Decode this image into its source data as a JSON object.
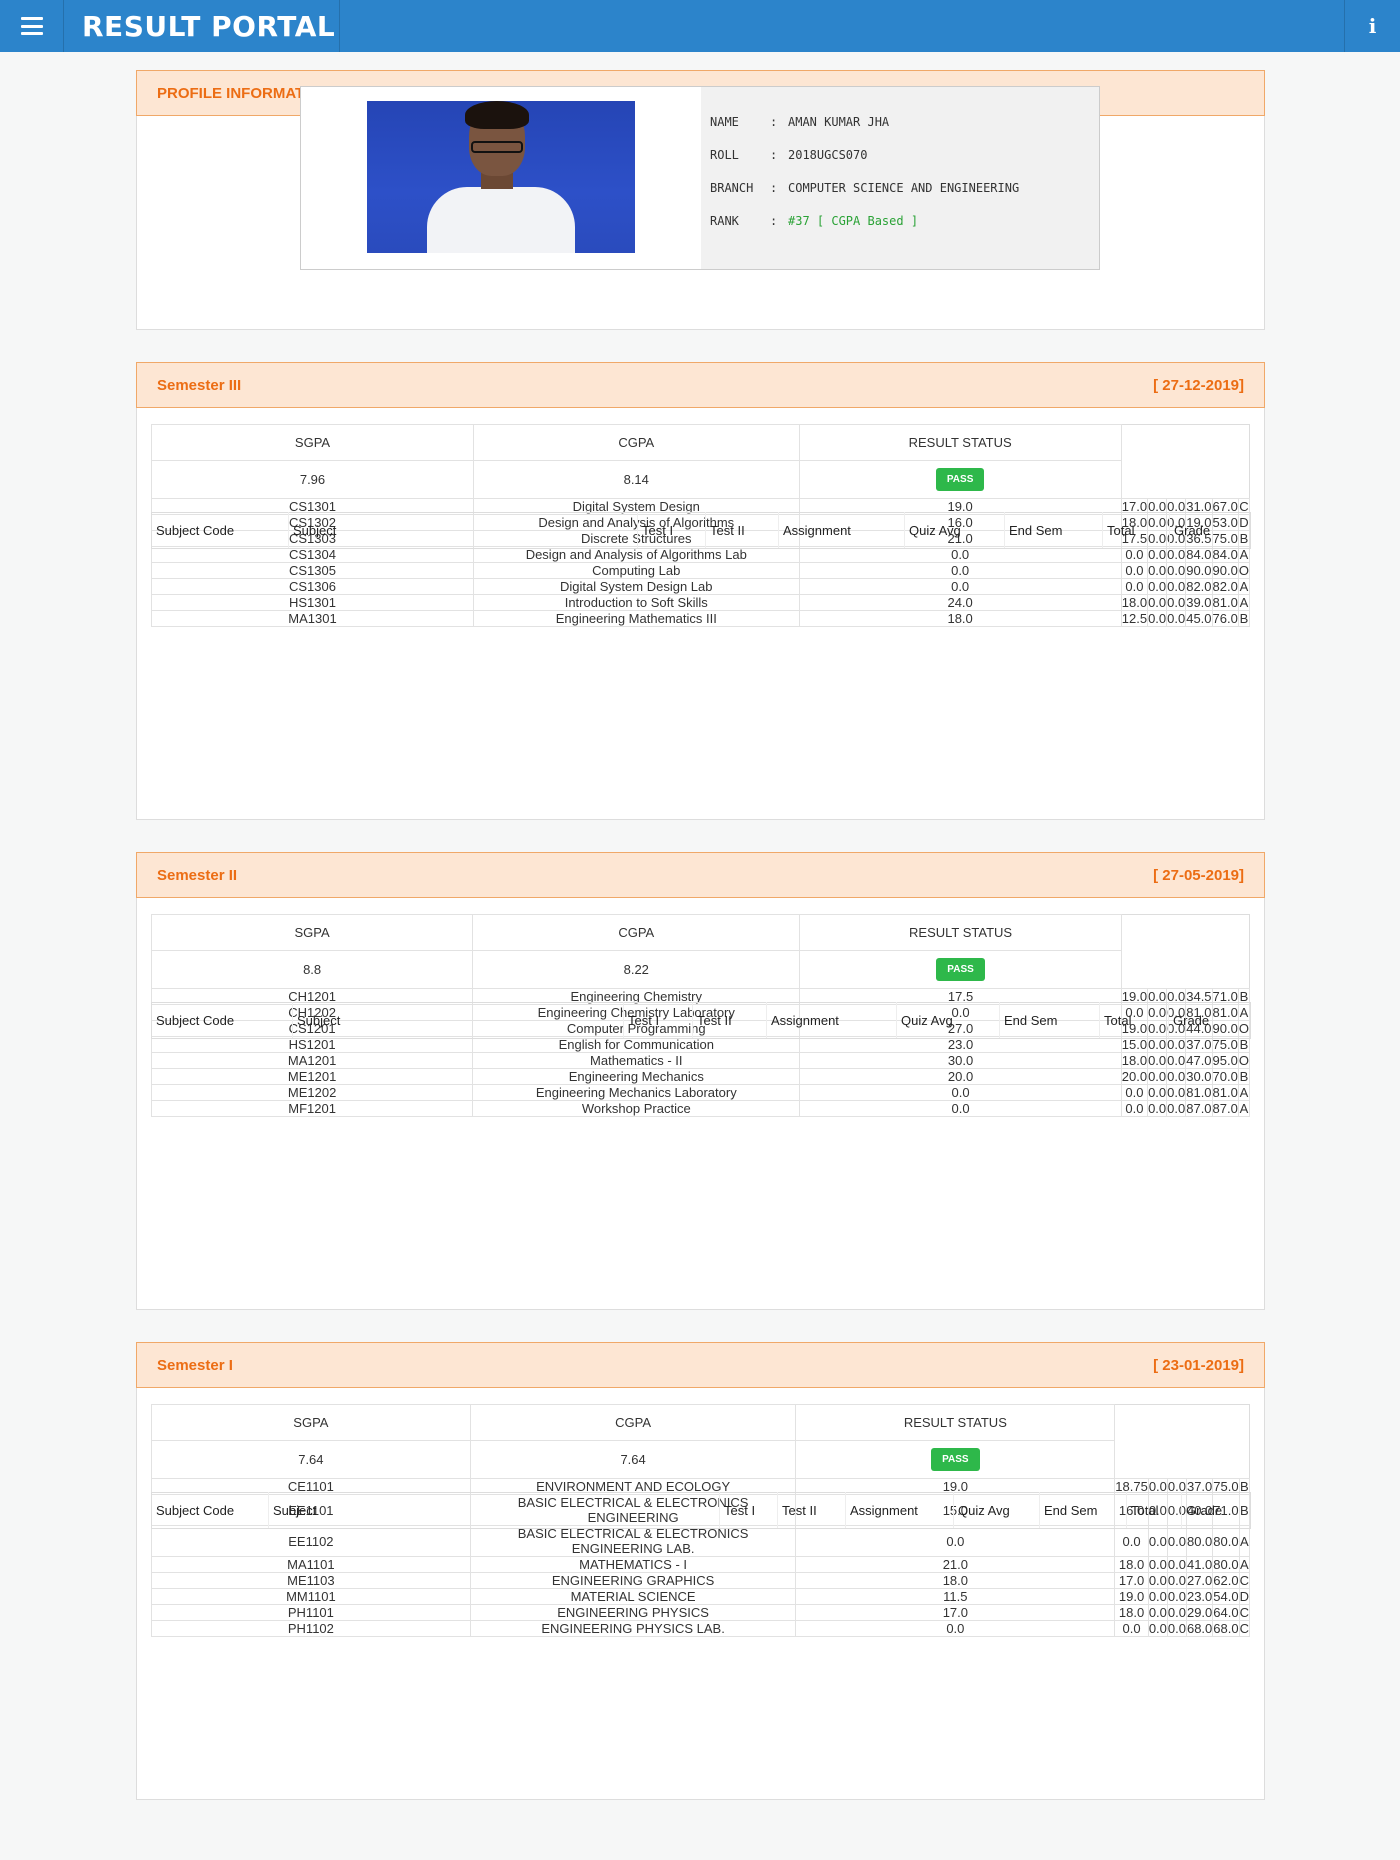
{
  "header": {
    "menu_icon": "hamburger-icon",
    "title": "RESULT PORTAL",
    "info_icon": "info-icon",
    "info_glyph": "i"
  },
  "profile": {
    "heading": "PROFILE INFORMATION",
    "fields": [
      {
        "label": "NAME",
        "value": "AMAN KUMAR JHA"
      },
      {
        "label": "ROLL",
        "value": "2018UGCS070"
      },
      {
        "label": "BRANCH",
        "value": "COMPUTER SCIENCE AND ENGINEERING"
      },
      {
        "label": "RANK",
        "value": "#37 [ CGPA Based ]"
      }
    ]
  },
  "columns": [
    "Subject Code",
    "Subject",
    "Test I",
    "Test II",
    "Assignment",
    "Quiz Avg",
    "End Sem",
    "Total",
    "Grade"
  ],
  "summary_labels": {
    "sgpa": "SGPA",
    "cgpa": "CGPA",
    "status": "RESULT STATUS"
  },
  "semesters": [
    {
      "title": "Semester III",
      "date": "[ 27-12-2019]",
      "sgpa": "7.96",
      "cgpa": "8.14",
      "status": "PASS",
      "rows": [
        [
          "CS1301",
          "Digital System Design",
          "19.0",
          "17.0",
          "0.0",
          "0.0",
          "31.0",
          "67.0",
          "C"
        ],
        [
          "CS1302",
          "Design and Analysis of Algorithms",
          "16.0",
          "18.0",
          "0.0",
          "0.0",
          "19.0",
          "53.0",
          "D"
        ],
        [
          "CS1303",
          "Discrete Structures",
          "21.0",
          "17.5",
          "0.0",
          "0.0",
          "36.5",
          "75.0",
          "B"
        ],
        [
          "CS1304",
          "Design and Analysis of Algorithms Lab",
          "0.0",
          "0.0",
          "0.0",
          "0.0",
          "84.0",
          "84.0",
          "A"
        ],
        [
          "CS1305",
          "Computing Lab",
          "0.0",
          "0.0",
          "0.0",
          "0.0",
          "90.0",
          "90.0",
          "O"
        ],
        [
          "CS1306",
          "Digital System Design Lab",
          "0.0",
          "0.0",
          "0.0",
          "0.0",
          "82.0",
          "82.0",
          "A"
        ],
        [
          "HS1301",
          "Introduction to Soft Skills",
          "24.0",
          "18.0",
          "0.0",
          "0.0",
          "39.0",
          "81.0",
          "A"
        ],
        [
          "MA1301",
          "Engineering Mathematics III",
          "18.0",
          "12.5",
          "0.0",
          "0.0",
          "45.0",
          "76.0",
          "B"
        ]
      ]
    },
    {
      "title": "Semester II",
      "date": "[ 27-05-2019]",
      "sgpa": "8.8",
      "cgpa": "8.22",
      "status": "PASS",
      "rows": [
        [
          "CH1201",
          "Engineering Chemistry",
          "17.5",
          "19.0",
          "0.0",
          "0.0",
          "34.5",
          "71.0",
          "B"
        ],
        [
          "CH1202",
          "Engineering Chemistry Laboratory",
          "0.0",
          "0.0",
          "0.0",
          "0.0",
          "81.0",
          "81.0",
          "A"
        ],
        [
          "CS1201",
          "Computer Programming",
          "27.0",
          "19.0",
          "0.0",
          "0.0",
          "44.0",
          "90.0",
          "O"
        ],
        [
          "HS1201",
          "English for Communication",
          "23.0",
          "15.0",
          "0.0",
          "0.0",
          "37.0",
          "75.0",
          "B"
        ],
        [
          "MA1201",
          "Mathematics - II",
          "30.0",
          "18.0",
          "0.0",
          "0.0",
          "47.0",
          "95.0",
          "O"
        ],
        [
          "ME1201",
          "Engineering Mechanics",
          "20.0",
          "20.0",
          "0.0",
          "0.0",
          "30.0",
          "70.0",
          "B"
        ],
        [
          "ME1202",
          "Engineering Mechanics Laboratory",
          "0.0",
          "0.0",
          "0.0",
          "0.0",
          "81.0",
          "81.0",
          "A"
        ],
        [
          "MF1201",
          "Workshop Practice",
          "0.0",
          "0.0",
          "0.0",
          "0.0",
          "87.0",
          "87.0",
          "A"
        ]
      ]
    },
    {
      "title": "Semester I",
      "date": "[ 23-01-2019]",
      "sgpa": "7.64",
      "cgpa": "7.64",
      "status": "PASS",
      "rows": [
        [
          "CE1101",
          "ENVIRONMENT AND ECOLOGY",
          "19.0",
          "18.75",
          "0.0",
          "0.0",
          "37.0",
          "75.0",
          "B"
        ],
        [
          "EE1101",
          "BASIC ELECTRICAL & ELECTRONICS ENGINEERING",
          "15.0",
          "16.0",
          "0.0",
          "0.0",
          "40.0",
          "71.0",
          "B"
        ],
        [
          "EE1102",
          "BASIC ELECTRICAL & ELECTRONICS ENGINEERING LAB.",
          "0.0",
          "0.0",
          "0.0",
          "0.0",
          "80.0",
          "80.0",
          "A"
        ],
        [
          "MA1101",
          "MATHEMATICS - I",
          "21.0",
          "18.0",
          "0.0",
          "0.0",
          "41.0",
          "80.0",
          "A"
        ],
        [
          "ME1103",
          "ENGINEERING GRAPHICS",
          "18.0",
          "17.0",
          "0.0",
          "0.0",
          "27.0",
          "62.0",
          "C"
        ],
        [
          "MM1101",
          "MATERIAL SCIENCE",
          "11.5",
          "19.0",
          "0.0",
          "0.0",
          "23.0",
          "54.0",
          "D"
        ],
        [
          "PH1101",
          "ENGINEERING PHYSICS",
          "17.0",
          "18.0",
          "0.0",
          "0.0",
          "29.0",
          "64.0",
          "C"
        ],
        [
          "PH1102",
          "ENGINEERING PHYSICS LAB.",
          "0.0",
          "0.0",
          "0.0",
          "0.0",
          "68.0",
          "68.0",
          "C"
        ]
      ]
    }
  ]
}
